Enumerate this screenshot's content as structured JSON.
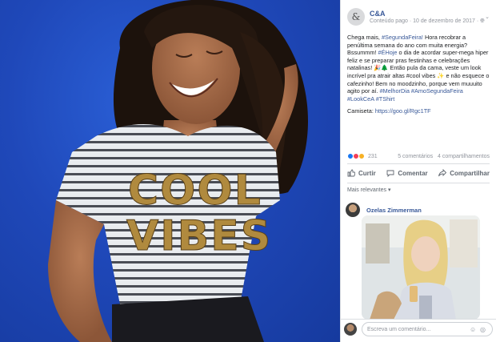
{
  "post": {
    "page_name": "C&A",
    "avatar_letter": "&",
    "meta_text": "Conteúdo pago · 10 de dezembro de 2017 · ",
    "globe_icon": "globe-icon",
    "paragraph1_pre": "Chega mais, ",
    "tag_segunda": "#SegundaFeira!",
    "paragraph1_mid": " Hora recobrar a penúltima semana do ano com muita energia? Bssummm! ",
    "tag_hoje": "#ÉHoje",
    "paragraph1_post": " o dia de acordar super-mega hiper feliz e se preparar pras festinhas e celebrações natalinas! ",
    "paragraph1_tail": " Então pula da cama, veste um look incrível pra atrair altas #cool vibes ✨ e não esquece o cafezinho! Bem no moodzinho, porque vem muuuito agito por aí. ",
    "tag_melhor": "#MelhorDia",
    "tag_amo": "#AmoSegundaFeira",
    "tag_look": "#LookCeA",
    "tag_tshirt": "#TShirt",
    "camiseta_label": "Camiseta: ",
    "camiseta_link": "https://goo.gl/Rgc1TF"
  },
  "reactions": {
    "count": "231",
    "comments": "5 comentários",
    "shares": "4 compartilhamentos"
  },
  "actions": {
    "like": "Curtir",
    "comment": "Comentar",
    "share": "Compartilhar"
  },
  "comments": {
    "filter_label": "Mais relevantes ▾",
    "first_author": "Ozelas Zimmerman"
  },
  "composer": {
    "placeholder": "Escreva um comentário..."
  },
  "colors": {
    "link": "#385898",
    "photo_bg": "#1f48b9"
  }
}
